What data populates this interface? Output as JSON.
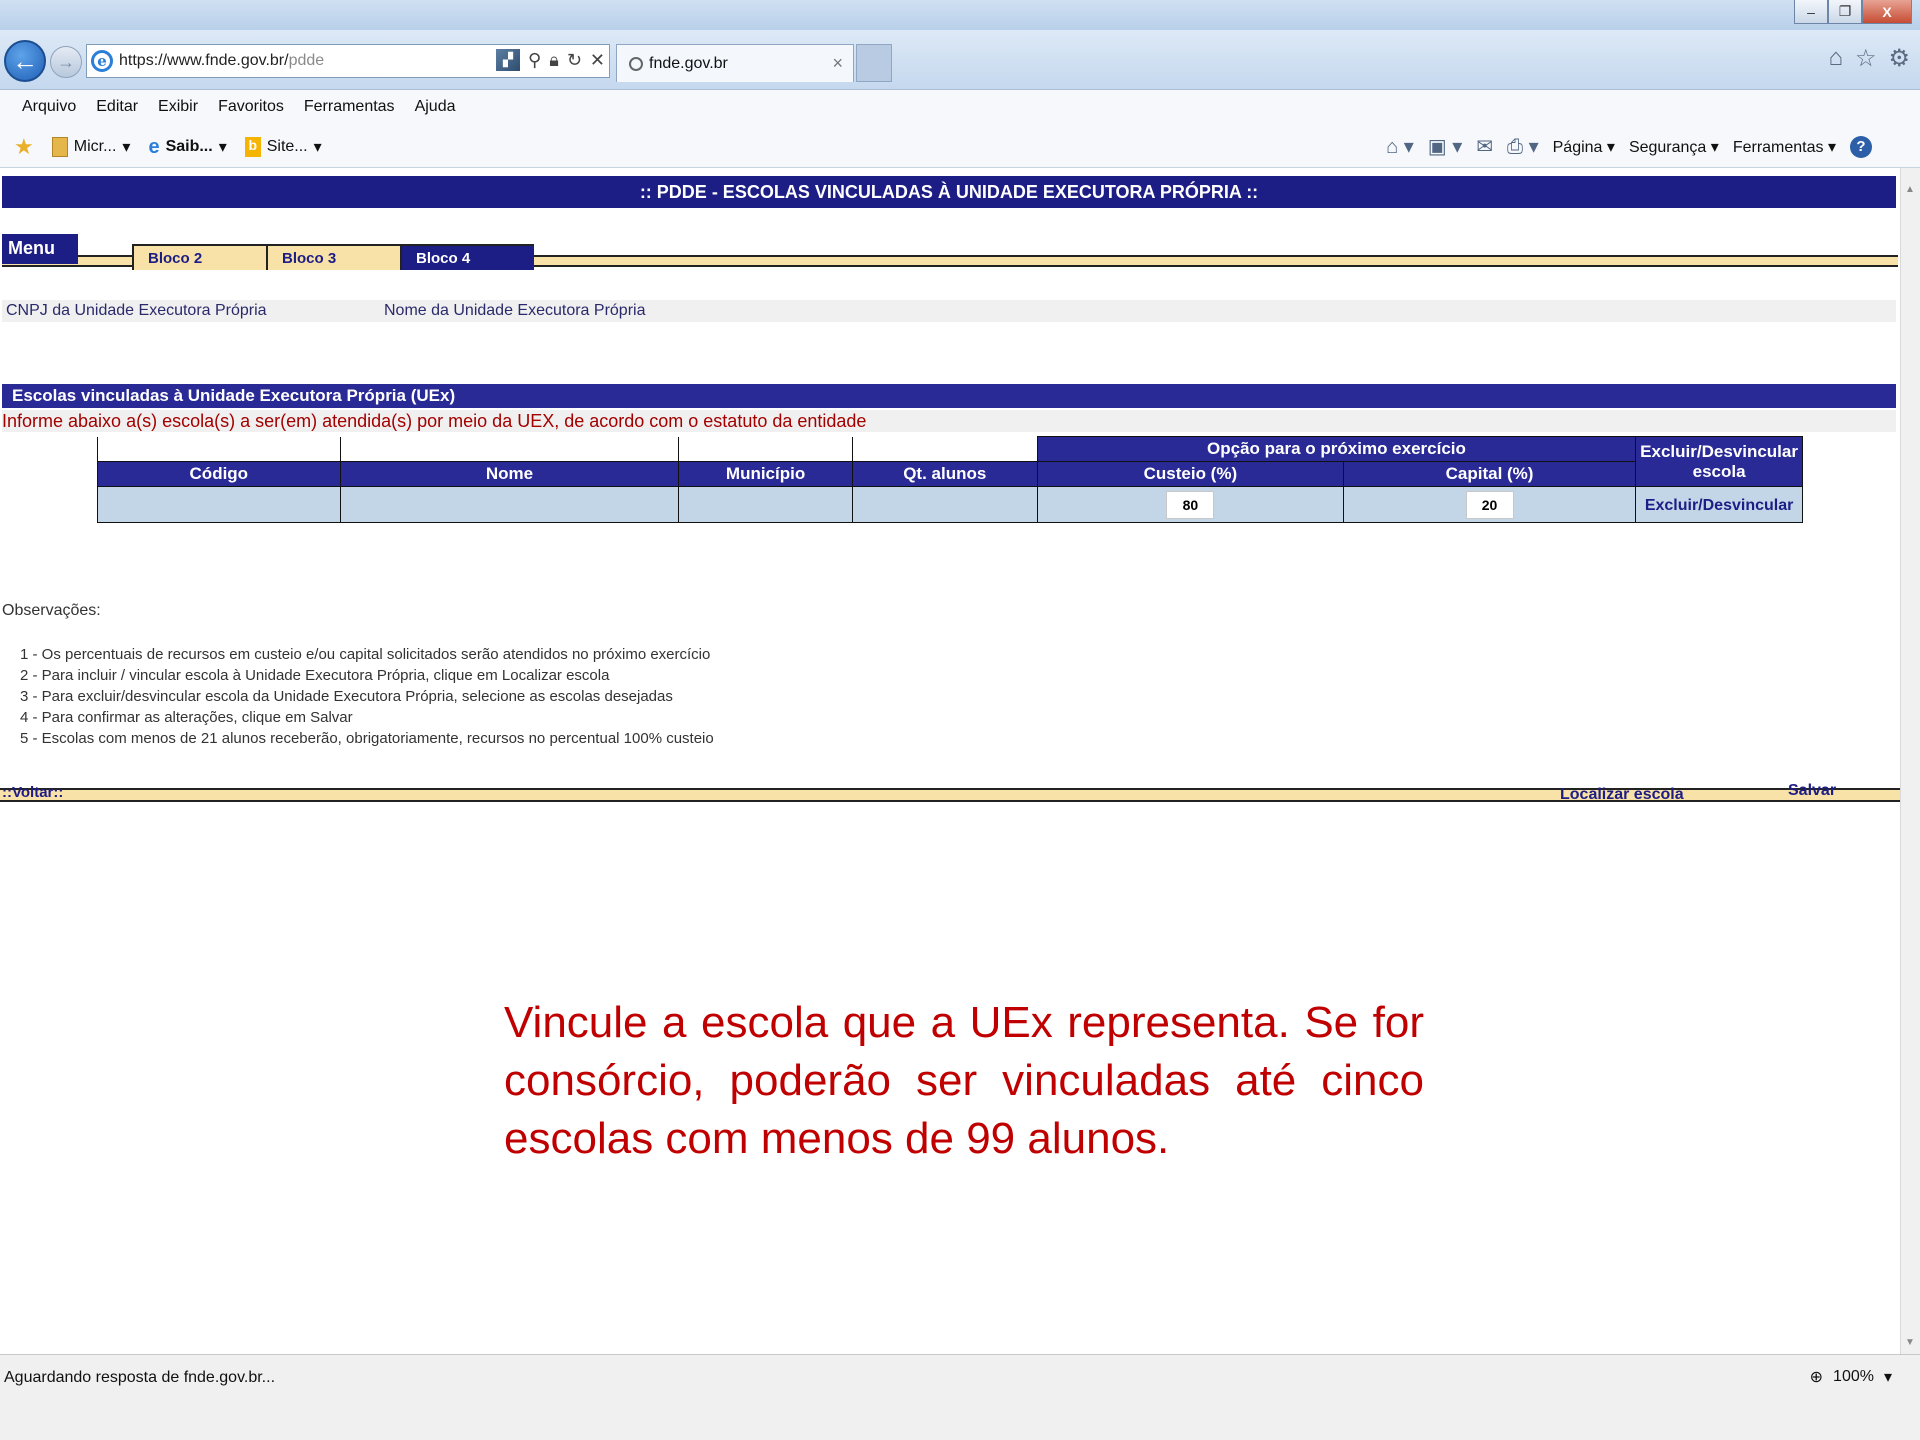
{
  "browser": {
    "url_main": "https://www.fnde.gov.br/",
    "url_dim": "pdde",
    "tab_title": "fnde.gov.br",
    "menus": [
      "Arquivo",
      "Editar",
      "Exibir",
      "Favoritos",
      "Ferramentas",
      "Ajuda"
    ],
    "favorites": [
      {
        "label": "Micr...",
        "icon": "folder-icon"
      },
      {
        "label": "Saib...",
        "icon": "ie-icon"
      },
      {
        "label": "Site...",
        "icon": "bing-icon"
      }
    ],
    "commands": [
      "Página",
      "Segurança",
      "Ferramentas"
    ],
    "status": "Aguardando resposta de fnde.gov.br...",
    "zoom": "100%"
  },
  "page": {
    "banner": ":: PDDE - ESCOLAS VINCULADAS À UNIDADE EXECUTORA PRÓPRIA ::",
    "tabs": {
      "menu": "Menu",
      "bloco2": "Bloco 2",
      "bloco3": "Bloco 3",
      "bloco4": "Bloco 4"
    },
    "cnpj_label": "CNPJ da Unidade Executora Própria",
    "nome_label": "Nome da Unidade Executora Própria",
    "section_title": "Escolas vinculadas à Unidade Executora Própria (UEx)",
    "inform": "Informe abaixo a(s) escola(s) a ser(em) atendida(s) por meio da UEX, de acordo com o estatuto da entidade",
    "table": {
      "group_header": "Opção para o próximo exercício",
      "col_codigo": "Código",
      "col_nome": "Nome",
      "col_municipio": "Município",
      "col_qt": "Qt. alunos",
      "col_custeio": "Custeio (%)",
      "col_capital": "Capital (%)",
      "col_excluir": "Excluir/Desvincular escola",
      "row": {
        "codigo": "",
        "nome": "",
        "municipio": "",
        "qt": "",
        "custeio": "80",
        "capital": "20",
        "link": "Excluir/Desvincular"
      }
    },
    "obs_title": "Observações:",
    "obs": [
      "1 - Os percentuais de recursos em custeio e/ou capital solicitados serão atendidos no próximo exercício",
      "2 - Para incluir / vincular escola à Unidade Executora Própria, clique em Localizar escola",
      "3 - Para excluir/desvincular escola da Unidade Executora Própria, selecione as escolas desejadas",
      "4 - Para confirmar as alterações, clique em Salvar",
      "5 - Escolas com menos de 21 alunos receberão, obrigatoriamente, recursos no percentual 100% custeio"
    ],
    "voltar": "::Voltar::",
    "localizar": "Localizar escola",
    "salvar": "Salvar",
    "callout": "Vincule a escola que a UEx representa. Se for consórcio, poderão ser vinculadas até cinco escolas com menos de 99 alunos."
  }
}
